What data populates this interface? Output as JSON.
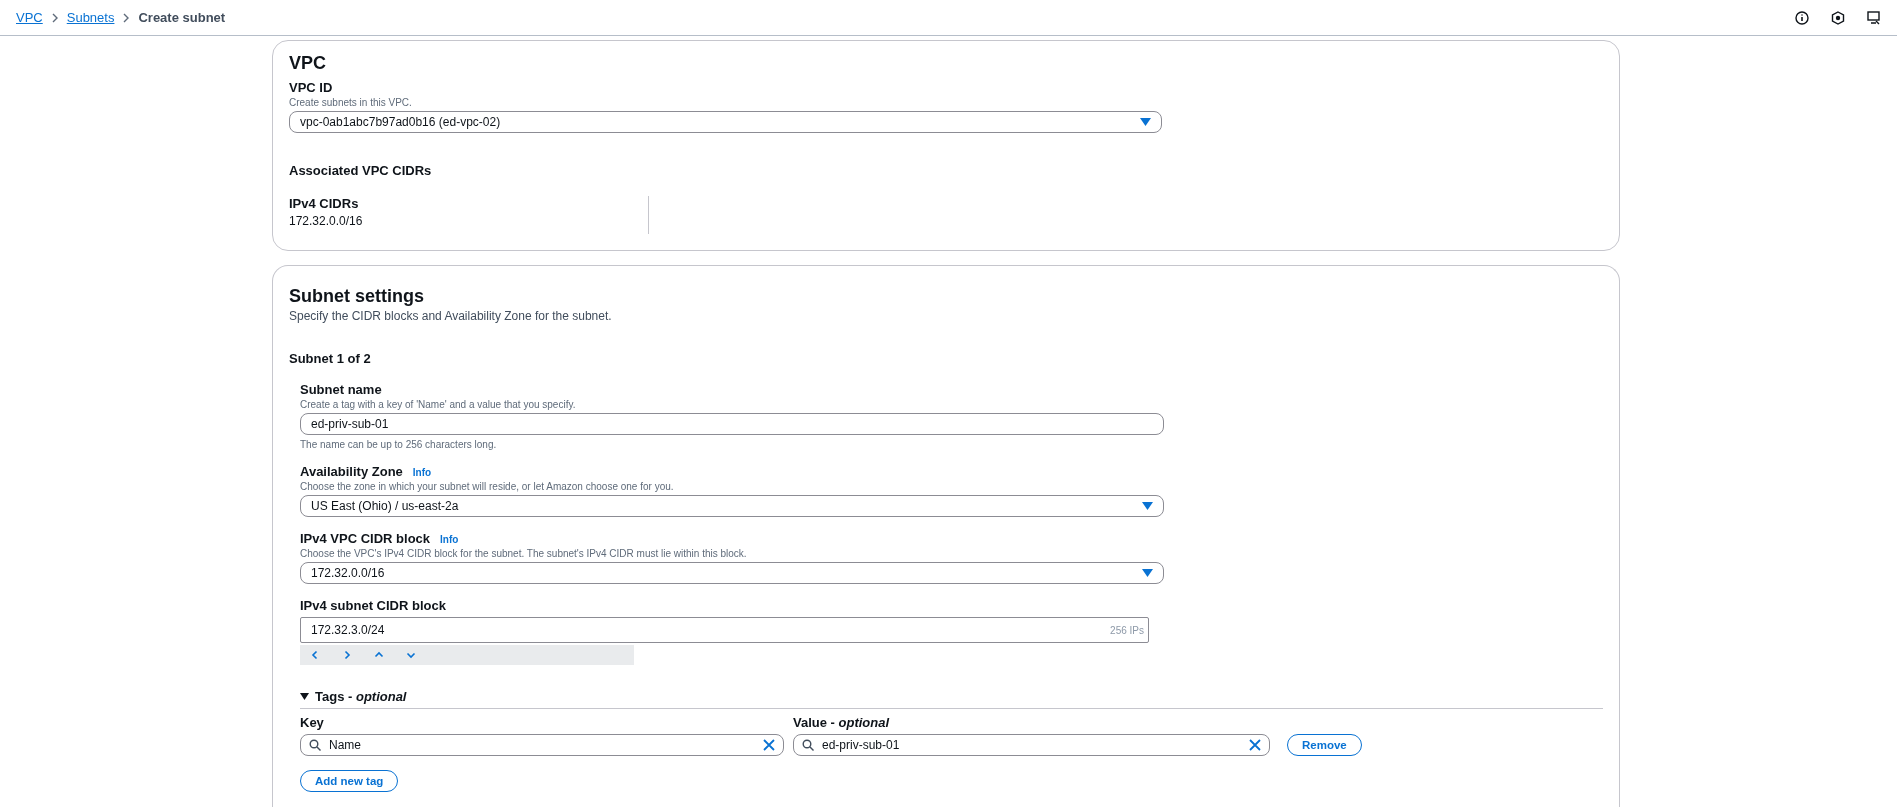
{
  "breadcrumbs": [
    {
      "label": "VPC",
      "link": true
    },
    {
      "label": "Subnets",
      "link": true
    },
    {
      "label": "Create subnet",
      "link": false
    }
  ],
  "vpc_card": {
    "title": "VPC",
    "vpc_id": {
      "label": "VPC ID",
      "hint": "Create subnets in this VPC.",
      "value": "vpc-0ab1abc7b97ad0b16 (ed-vpc-02)"
    },
    "associated_title": "Associated VPC CIDRs",
    "cidrs": {
      "label": "IPv4 CIDRs",
      "value": "172.32.0.0/16"
    }
  },
  "subnet_card": {
    "title": "Subnet settings",
    "description": "Specify the CIDR blocks and Availability Zone for the subnet.",
    "subnet_heading": "Subnet 1 of 2",
    "fields": [
      {
        "kind": "text",
        "label": "Subnet name",
        "hint": "Create a tag with a key of 'Name' and a value that you specify.",
        "value": "ed-priv-sub-01",
        "helper": "The name can be up to 256 characters long."
      },
      {
        "kind": "select",
        "label": "Availability Zone",
        "info": "Info",
        "hint": "Choose the zone in which your subnet will reside, or let Amazon choose one for you.",
        "value": "US East (Ohio) / us-east-2a"
      },
      {
        "kind": "select",
        "label": "IPv4 VPC CIDR block",
        "info": "Info",
        "hint": "Choose the VPC's IPv4 CIDR block for the subnet. The subnet's IPv4 CIDR must lie within this block.",
        "value": "172.32.0.0/16"
      },
      {
        "kind": "cidr",
        "label": "IPv4 subnet CIDR block",
        "value": "172.32.3.0/24",
        "suffix": "256 IPs"
      }
    ],
    "tags": {
      "title": "Tags - *optional*",
      "expanded": true,
      "key_label": "Key",
      "value_label": "Value - *optional*",
      "rows": [
        {
          "key": "Name",
          "value": "ed-priv-sub-01",
          "remove": "Remove"
        }
      ],
      "add": "Add new tag"
    }
  }
}
